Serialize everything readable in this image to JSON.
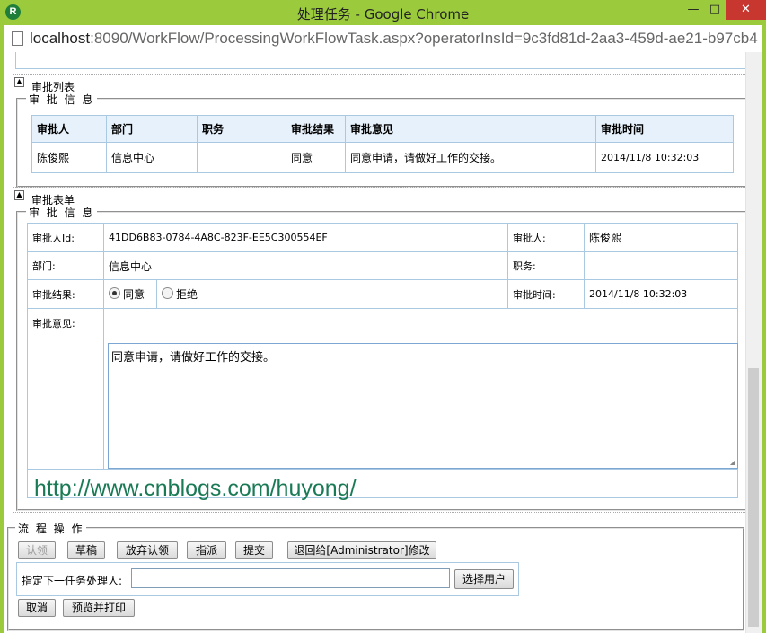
{
  "window": {
    "title": "处理任务 - Google Chrome",
    "app_icon": "R"
  },
  "address_bar": {
    "host": "localhost",
    "path": ":8090/WorkFlow/ProcessingWorkFlowTask.aspx?operatorInsId=9c3fd81d-2aa3-459d-ae21-b97cb4"
  },
  "approval_list": {
    "section_title": "审批列表",
    "legend": "审 批 信 息",
    "headers": [
      "审批人",
      "部门",
      "职务",
      "审批结果",
      "审批意见",
      "审批时间"
    ],
    "rows": [
      [
        "陈俊熙",
        "信息中心",
        "",
        "同意",
        "同意申请，请做好工作的交接。",
        "2014/11/8 10:32:03"
      ]
    ]
  },
  "approval_form": {
    "section_title": "审批表单",
    "legend": "审 批 信 息",
    "approver_id_label": "审批人Id:",
    "approver_id_value": "41DD6B83-0784-4A8C-823F-EE5C300554EF",
    "approver_label": "审批人:",
    "approver_value": "陈俊熙",
    "department_label": "部门:",
    "department_value": "信息中心",
    "position_label": "职务:",
    "position_value": "",
    "result_label": "审批结果:",
    "result_options": [
      "同意",
      "拒绝"
    ],
    "result_selected": "同意",
    "time_label": "审批时间:",
    "time_value": "2014/11/8 10:32:03",
    "opinion_label": "审批意见:",
    "opinion_value": "同意申请，请做好工作的交接。",
    "watermark_link": "http://www.cnblogs.com/huyong/"
  },
  "workflow_ops": {
    "legend": "流 程 操 作",
    "buttons": [
      "认领",
      "草稿",
      "放弃认领",
      "指派",
      "提交",
      "退回给[Administrator]修改"
    ],
    "next_handler_label": "指定下一任务处理人:",
    "next_handler_value": "",
    "select_user_button": "选择用户",
    "cancel_button": "取消",
    "preview_print_button": "预览并打印"
  }
}
